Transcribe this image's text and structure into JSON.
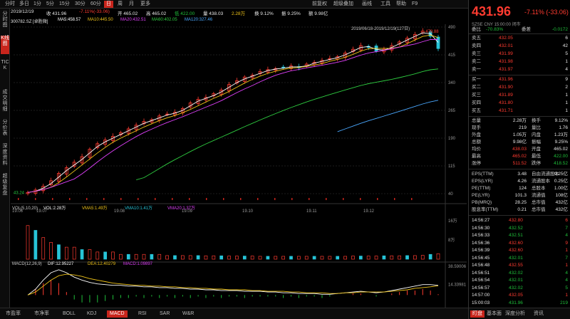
{
  "top_tabs": [
    "分时",
    "多日",
    "1分",
    "5分",
    "15分",
    "30分",
    "60分",
    "日",
    "周",
    "月",
    "更多"
  ],
  "top_tabs_active_index": 7,
  "top_right_tabs": [
    "前复权",
    "超级叠加",
    "画线",
    "工具",
    "帮助",
    "F9"
  ],
  "left_nav": [
    {
      "label": "分时图",
      "active": false
    },
    {
      "label": "K线图",
      "active": true
    },
    {
      "label": "TICK",
      "active": false
    },
    {
      "label": "成交明细",
      "active": false
    },
    {
      "label": "分价表",
      "active": false
    },
    {
      "label": "深度资料",
      "active": false
    },
    {
      "label": "超级复盘",
      "active": false
    }
  ],
  "info_line": {
    "date": "2019/12/19",
    "close_label": "收 431.96",
    "change": "-7.11%(-33.06)",
    "open": "开 465.02",
    "high": "高 465.02",
    "low": "低 422.00",
    "amount": "量 438.03",
    "vol": "2.28万",
    "turnover": "换 9.12%",
    "amplitude": "振 9.25%",
    "total": "额 9.98亿"
  },
  "ma_line": {
    "code": "300782.SZ [卓胜微]",
    "ma5": "MA5:458.57",
    "ma10": "MA10:445.50",
    "ma20": "MA20:432.51",
    "ma60": "MA60:402.05",
    "ma120": "MA120:327.46"
  },
  "range_label": "2019/06/18-2019/12/19(127日)",
  "price_axis": [
    "490",
    "415",
    "340",
    "265",
    "190",
    "115",
    "40"
  ],
  "high_mark": "478.88",
  "low_mark": "43.24",
  "date_axis": [
    "19.06",
    "19.07",
    "19.08",
    "19.09",
    "19.10",
    "19.11",
    "19.12"
  ],
  "vol_header": {
    "title": "VOL(5,10,20)",
    "vol": "VOL:2.28万",
    "v5": "VMA5:1.49万",
    "v10": "VMA10:1.41万",
    "v20": "VMA20:1.37万"
  },
  "vol_axis": [
    "16万",
    "8万"
  ],
  "macd_header": {
    "title": "MACD(12,26,9)",
    "dif": "DIF:12.95227",
    "dea": "DEA:12.40279",
    "macd": "MACD:1.09897"
  },
  "macd_axis": [
    "38.59006",
    "14.33981"
  ],
  "bottom_tabs": [
    "市盈率",
    "市净率",
    "BOLL",
    "KDJ",
    "MACD",
    "RSI",
    "SAR",
    "W&R"
  ],
  "bottom_tabs_active_index": 4,
  "right_panel": {
    "price": "431.96",
    "change": "-7.11% (-33.06)",
    "sub": "SZSE  CNY  15:00:00  闭市",
    "weibi_label": "委比",
    "weibi": "-70.83%",
    "weicha_label": "委差",
    "weicha": "-0.0172",
    "asks": [
      {
        "label": "卖五",
        "price": "432.05",
        "vol": "6"
      },
      {
        "label": "卖四",
        "price": "432.01",
        "vol": "42"
      },
      {
        "label": "卖三",
        "price": "431.99",
        "vol": "5"
      },
      {
        "label": "卖二",
        "price": "431.98",
        "vol": "1"
      },
      {
        "label": "卖一",
        "price": "431.97",
        "vol": "4"
      }
    ],
    "bids": [
      {
        "label": "买一",
        "price": "431.96",
        "vol": "9"
      },
      {
        "label": "买二",
        "price": "431.90",
        "vol": "2"
      },
      {
        "label": "买三",
        "price": "431.89",
        "vol": "1"
      },
      {
        "label": "买四",
        "price": "431.80",
        "vol": "1"
      },
      {
        "label": "买五",
        "price": "431.71",
        "vol": "1"
      }
    ],
    "stats": [
      {
        "l1": "总量",
        "v1": "2.28万",
        "l2": "换手",
        "v2": "9.12%"
      },
      {
        "l1": "现手",
        "v1": "219",
        "l2": "量比",
        "v2": "1.76"
      },
      {
        "l1": "外盘",
        "v1": "1.05万",
        "l2": "内盘",
        "v2": "1.23万"
      },
      {
        "l1": "总额",
        "v1": "9.98亿",
        "l2": "振幅",
        "v2": "9.25%"
      },
      {
        "l1": "均价",
        "v1": "438.03",
        "l2": "开盘",
        "v2": "465.02"
      },
      {
        "l1": "最高",
        "v1": "465.02",
        "l2": "最低",
        "v2": "422.00"
      },
      {
        "l1": "涨停",
        "v1": "511.52",
        "l2": "跌停",
        "v2": "418.52"
      }
    ],
    "fundamentals": [
      {
        "l1": "EPS(TTM)",
        "v1": "3.48",
        "l2": "自由流通股本",
        "v2": "0.25亿"
      },
      {
        "l1": "EPS(LYR)",
        "v1": "4.26",
        "l2": "流通股本",
        "v2": "0.25亿"
      },
      {
        "l1": "PE(TTM)",
        "v1": "124",
        "l2": "总股本",
        "v2": "1.00亿"
      },
      {
        "l1": "PE(LYR)",
        "v1": "101.3",
        "l2": "流通值",
        "v2": "108亿"
      },
      {
        "l1": "PB(MRQ)",
        "v1": "28.25",
        "l2": "总市值",
        "v2": "432亿"
      },
      {
        "l1": "股息率(TTM)",
        "v1": "0.21",
        "l2": "总市值",
        "v2": "432亿"
      }
    ],
    "ticks": [
      {
        "t": "14:56:27",
        "p": "432.80",
        "v": "6",
        "c": "red"
      },
      {
        "t": "14:56:30",
        "p": "432.52",
        "v": "7",
        "c": "green"
      },
      {
        "t": "14:56:33",
        "p": "432.51",
        "v": "4",
        "c": "green"
      },
      {
        "t": "14:56:36",
        "p": "432.60",
        "v": "9",
        "c": "red"
      },
      {
        "t": "14:56:39",
        "p": "432.60",
        "v": "1",
        "c": "red"
      },
      {
        "t": "14:56:45",
        "p": "432.01",
        "v": "7",
        "c": "green"
      },
      {
        "t": "14:56:48",
        "p": "432.55",
        "v": "1",
        "c": "red"
      },
      {
        "t": "14:56:51",
        "p": "432.02",
        "v": "4",
        "c": "green"
      },
      {
        "t": "14:56:54",
        "p": "432.01",
        "v": "4",
        "c": "green"
      },
      {
        "t": "14:56:57",
        "p": "432.02",
        "v": "5",
        "c": "green"
      },
      {
        "t": "14:57:00",
        "p": "432.05",
        "v": "1",
        "c": "red"
      },
      {
        "t": "15:00:03",
        "p": "431.96",
        "v": "219",
        "c": "green"
      }
    ],
    "bottom_tabs": [
      "盯盘",
      "基本面",
      "深度分析",
      "资讯"
    ],
    "bottom_tabs_active_index": 0
  },
  "chart_data": [
    {
      "type": "candlestick",
      "title": "300782.SZ [卓胜微]",
      "x": [
        "19.06",
        "19.07",
        "19.08",
        "19.09",
        "19.10",
        "19.11",
        "19.12"
      ],
      "ylim": [
        40,
        490
      ],
      "close_series": [
        43.24,
        50,
        60,
        75,
        95,
        110,
        125,
        140,
        160,
        175,
        185,
        195,
        205,
        215,
        225,
        235,
        240,
        250,
        255,
        260,
        270,
        285,
        295,
        300,
        310,
        320,
        335,
        345,
        355,
        360,
        370,
        375,
        378,
        380,
        385,
        380,
        390,
        395,
        400,
        405,
        410,
        420,
        430,
        440,
        435,
        425,
        430,
        440,
        450,
        460,
        470,
        478.88,
        465,
        431.96
      ],
      "ma_series": [
        {
          "name": "MA5",
          "color": "#ffffff"
        },
        {
          "name": "MA10",
          "color": "#f0c419"
        },
        {
          "name": "MA20",
          "color": "#e040fb"
        },
        {
          "name": "MA60",
          "color": "#2ecc40"
        },
        {
          "name": "MA120",
          "color": "#4aa8ff"
        }
      ]
    },
    {
      "type": "bar",
      "title": "VOL(5,10,20)",
      "ylim": [
        0,
        16
      ],
      "values": [
        14,
        12,
        9,
        7,
        6,
        5,
        5,
        4,
        4,
        3,
        3,
        3,
        2,
        2,
        2,
        2,
        2,
        2,
        1.5,
        1.5,
        1.5,
        1.5,
        1.5,
        1.4,
        1.4,
        1.4,
        1.3,
        1.3,
        1.3,
        1.3,
        1.2,
        1.2,
        1.2,
        1.2,
        1.2,
        1.2,
        1.2,
        1.2,
        1.2,
        1.2,
        1.2,
        1.2,
        1.3,
        1.3,
        1.3,
        1.3,
        1.4,
        1.4,
        1.4,
        1.5,
        1.5,
        1.6,
        2.0,
        2.28
      ]
    },
    {
      "type": "line",
      "title": "MACD(12,26,9)",
      "ylim": [
        -15,
        38.59006
      ],
      "series": [
        {
          "name": "DIF",
          "values": [
            0,
            8,
            20,
            30,
            34,
            30,
            24,
            20,
            17,
            15,
            14,
            13,
            13,
            12,
            12,
            11,
            11,
            10,
            10,
            9,
            9,
            8,
            8,
            7,
            7,
            6,
            6,
            6,
            5,
            5,
            5,
            4,
            4,
            3,
            3,
            2,
            2,
            2,
            1,
            1,
            2,
            3,
            4,
            5,
            4,
            3,
            4,
            6,
            8,
            10,
            12,
            14,
            14,
            12.95227
          ]
        },
        {
          "name": "DEA",
          "values": [
            0,
            4,
            12,
            20,
            26,
            28,
            27,
            25,
            22,
            20,
            18,
            16,
            15,
            14,
            13,
            13,
            12,
            12,
            11,
            11,
            10,
            10,
            9,
            9,
            8,
            8,
            7,
            7,
            7,
            6,
            6,
            5,
            5,
            5,
            4,
            4,
            3,
            3,
            3,
            2,
            2,
            3,
            3,
            4,
            4,
            4,
            4,
            5,
            6,
            7,
            9,
            10,
            11,
            12.40279
          ]
        }
      ]
    }
  ]
}
